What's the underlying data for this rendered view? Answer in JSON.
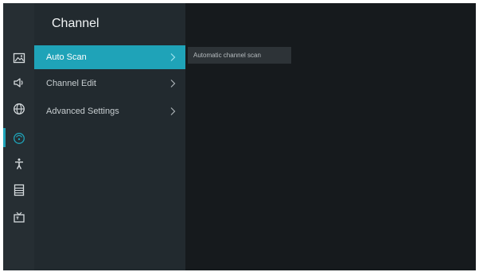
{
  "panel": {
    "title": "Channel",
    "items": [
      {
        "label": "Auto Scan",
        "selected": true
      },
      {
        "label": "Channel Edit",
        "selected": false
      },
      {
        "label": "Advanced Settings",
        "selected": false
      }
    ]
  },
  "tooltip": {
    "text": "Automatic channel scan"
  },
  "rail": {
    "icons": [
      "picture-icon",
      "sound-icon",
      "network-icon",
      "channel-icon",
      "accessibility-icon",
      "system-icon",
      "tv-icon"
    ],
    "active": "channel-icon"
  },
  "colors": {
    "accent": "#1fa3b8",
    "background": "#161a1d",
    "panel": "#222a2f",
    "rail": "#262e33",
    "tooltip_bg": "#2d3337"
  }
}
